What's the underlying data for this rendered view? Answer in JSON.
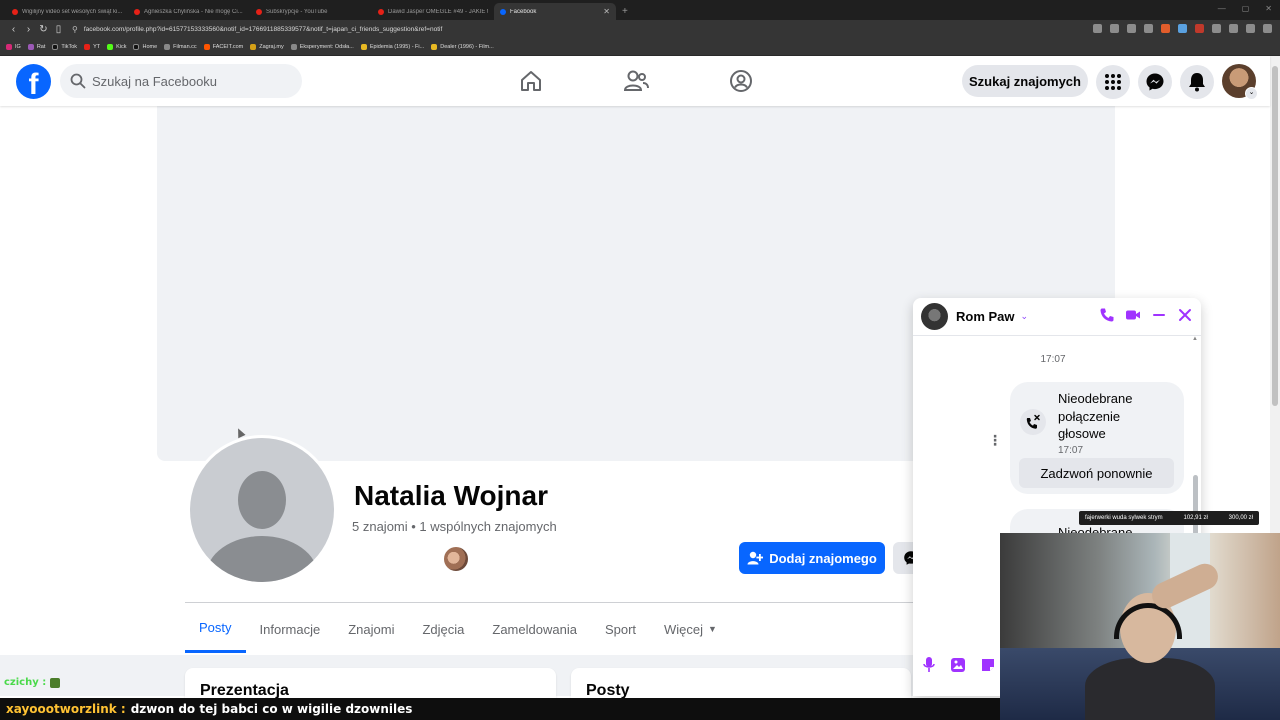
{
  "browser": {
    "tabs": [
      {
        "title": "Wigilijny video set wesołych świąt ki...",
        "icon": "youtube",
        "active": false
      },
      {
        "title": "Agnieszka Chylińska - Nie mogę Ci...",
        "icon": "youtube",
        "active": false
      },
      {
        "title": "Subskrypcje - YouTube",
        "icon": "youtube",
        "active": false
      },
      {
        "title": "Dawid Jasper OMEGLE #49 - JAKIE t...",
        "icon": "youtube",
        "active": false
      },
      {
        "title": "Facebook",
        "icon": "facebook",
        "active": true
      }
    ],
    "url": "facebook.com/profile.php?id=61577153333560&notif_id=1766911885339577&notif_t=japan_ci_friends_suggestion&ref=notif",
    "bookmarks": [
      "IG",
      "Rat",
      "TikTok",
      "YT",
      "Kick",
      "Home",
      "Filman.cc",
      "FACEIT.com",
      "Zagraj.my",
      "Eksperyment: Odsła...",
      "Epidemia (1995) - Fi...",
      "Dealer (1996) - Film..."
    ]
  },
  "facebook": {
    "search_placeholder": "Szukaj na Facebooku",
    "find_friends": "Szukaj znajomych"
  },
  "profile": {
    "name": "Natalia Wojnar",
    "friends_line": "5 znajomi • 1 wspólnych znajomych",
    "add_friend": "Dodaj znajomego",
    "tabs": [
      {
        "label": "Posty",
        "active": true
      },
      {
        "label": "Informacje",
        "active": false
      },
      {
        "label": "Znajomi",
        "active": false
      },
      {
        "label": "Zdjęcia",
        "active": false
      },
      {
        "label": "Zameldowania",
        "active": false
      },
      {
        "label": "Sport",
        "active": false
      },
      {
        "label": "Więcej",
        "active": false
      }
    ],
    "card_left": "Prezentacja",
    "card_right": "Posty"
  },
  "chat": {
    "contact": "Rom Paw",
    "time_divider": "17:07",
    "missed_call": {
      "title": "Nieodebrane połączenie głosowe",
      "time": "17:07",
      "action": "Zadzwoń ponownie"
    },
    "second_bubble": "Nieodebrane"
  },
  "stream": {
    "donation": {
      "text": "fajerwerki wuda sylwek strym",
      "collected": "102,91 zł",
      "goal": "300,00 zł"
    },
    "chat_line_1_user": "czichy :",
    "chat_line_2_user": "xayoootworzlink :",
    "chat_line_2_message": "dzwon do tej babci co w wigilie dzowniles"
  },
  "colors": {
    "facebook_blue": "#0866ff",
    "messenger_purple": "#a033ff",
    "chat_user_yellow": "#ffc233"
  }
}
